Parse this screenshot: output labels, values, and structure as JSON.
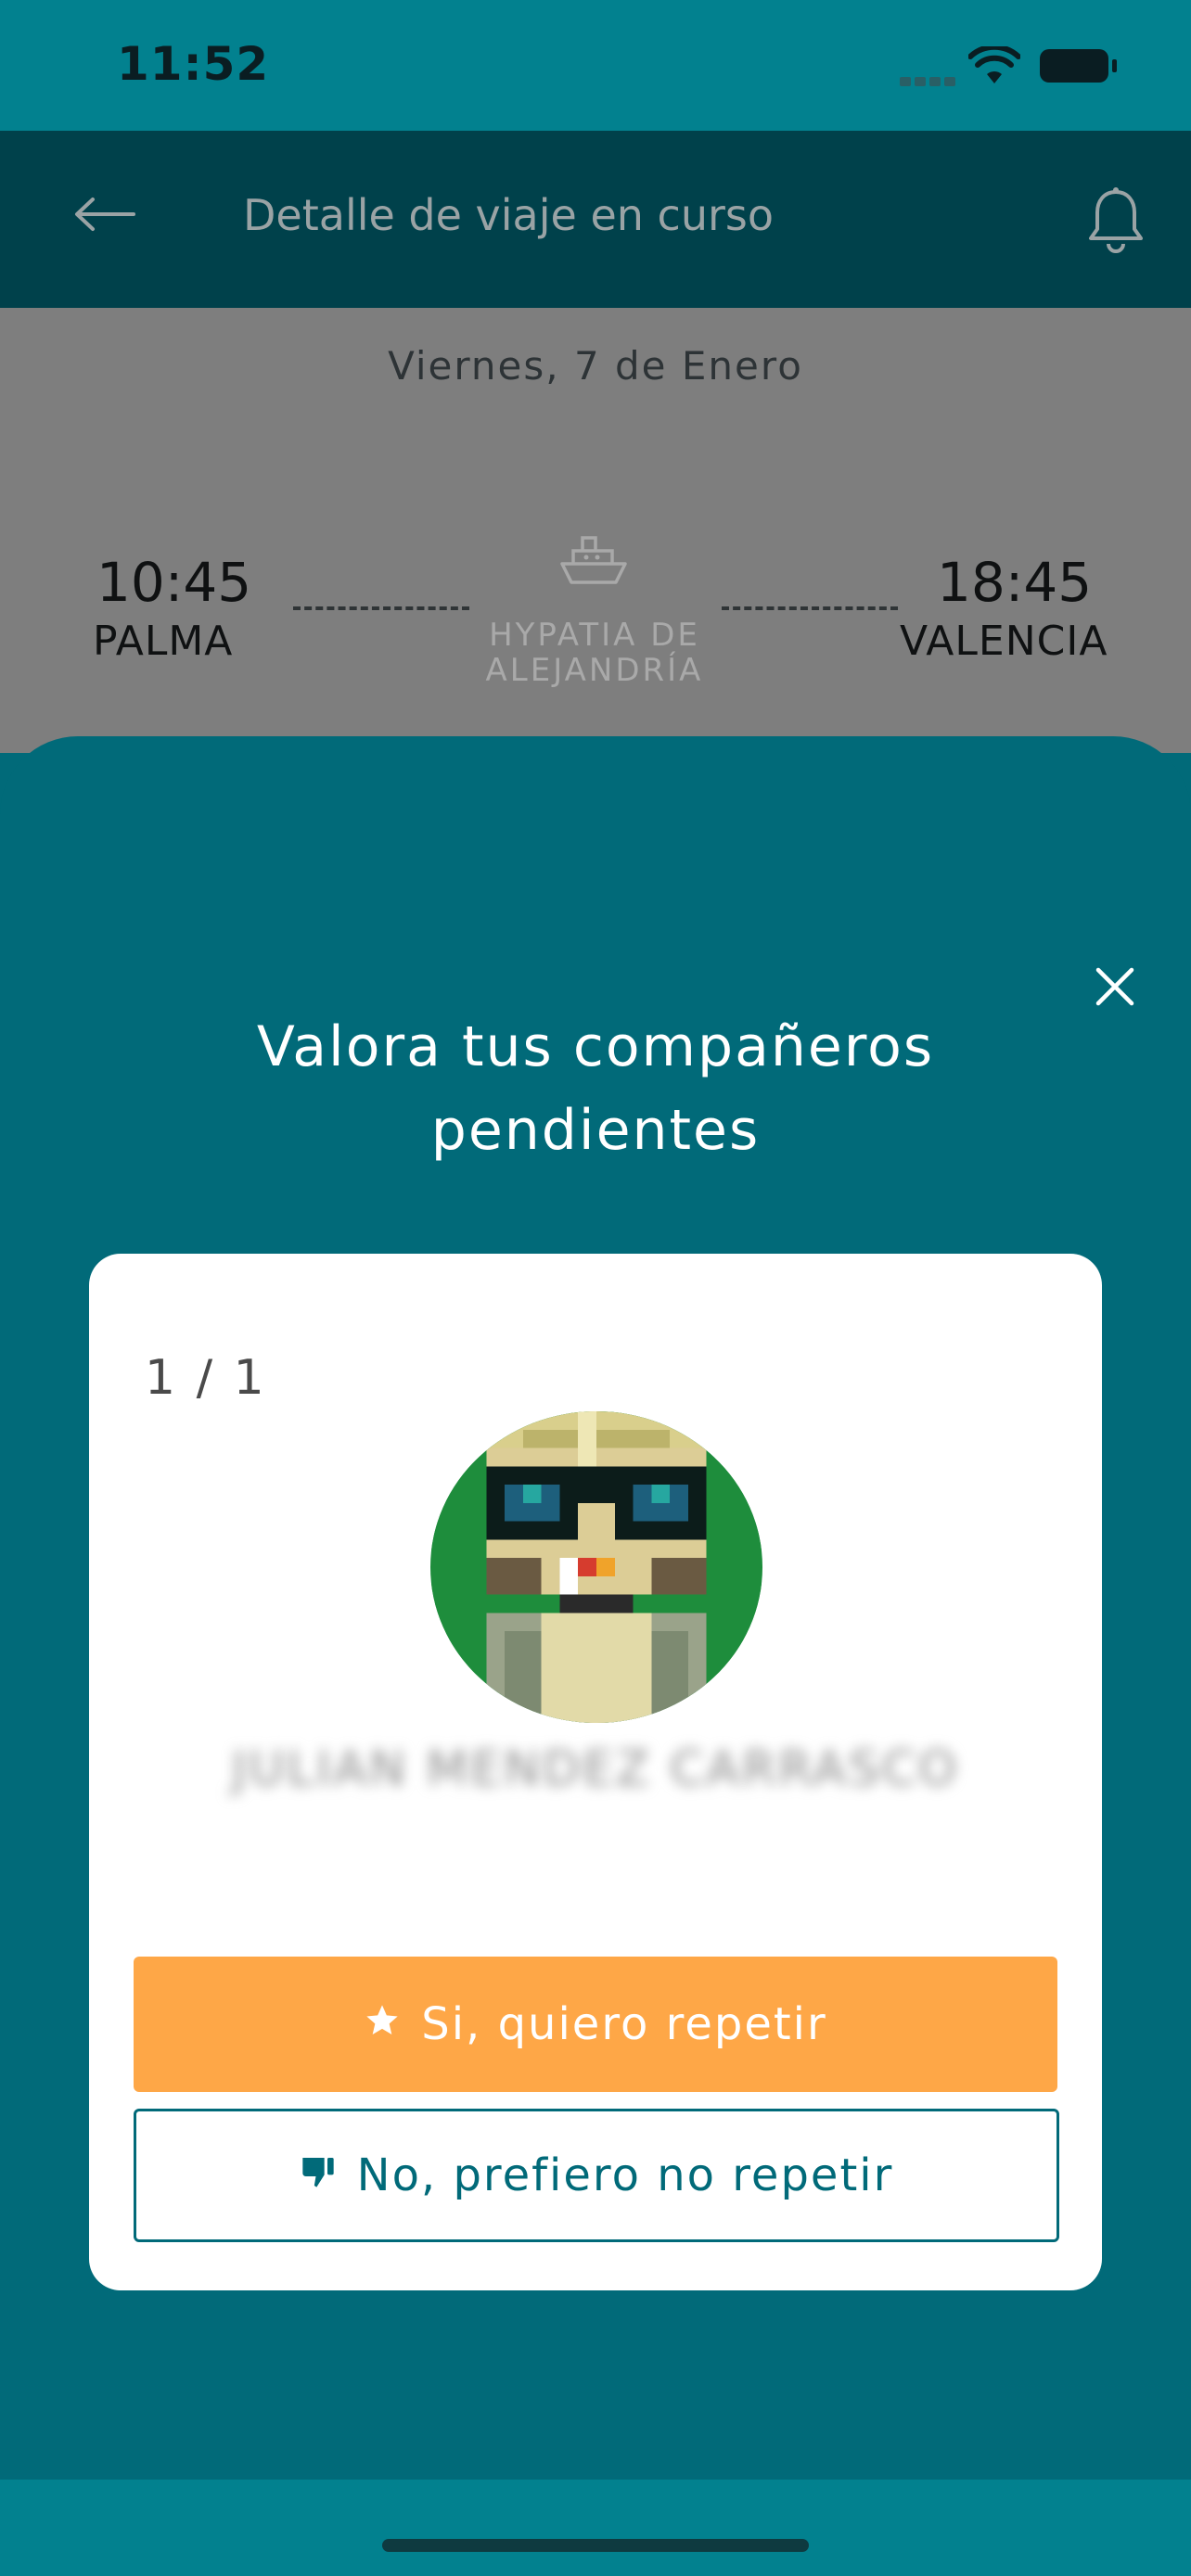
{
  "status_bar": {
    "time": "11:52"
  },
  "header": {
    "title": "Detalle de viaje en curso"
  },
  "trip": {
    "date": "Viernes, 7 de Enero",
    "departure": {
      "time": "10:45",
      "city": "PALMA"
    },
    "arrival": {
      "time": "18:45",
      "city": "VALENCIA"
    },
    "vessel_line1": "HYPATIA DE",
    "vessel_line2": "ALEJANDRÍA"
  },
  "rating_sheet": {
    "title_line1": "Valora tus compañeros",
    "title_line2": "pendientes",
    "counter": "1 / 1",
    "user_name": "JULIAN MENDEZ CARRASCO",
    "yes_label": "Si, quiero repetir",
    "no_label": "No, prefiero no repetir"
  },
  "colors": {
    "status_bar": "#02818f",
    "header": "#00414b",
    "sheet": "#016a79",
    "primary_button": "#fea747",
    "outline_button": "#016a79"
  },
  "icons": [
    "back-arrow-icon",
    "bell-icon",
    "ship-icon",
    "close-icon",
    "star-icon",
    "thumbs-down-icon",
    "wifi-icon",
    "battery-icon",
    "signal-icon"
  ]
}
